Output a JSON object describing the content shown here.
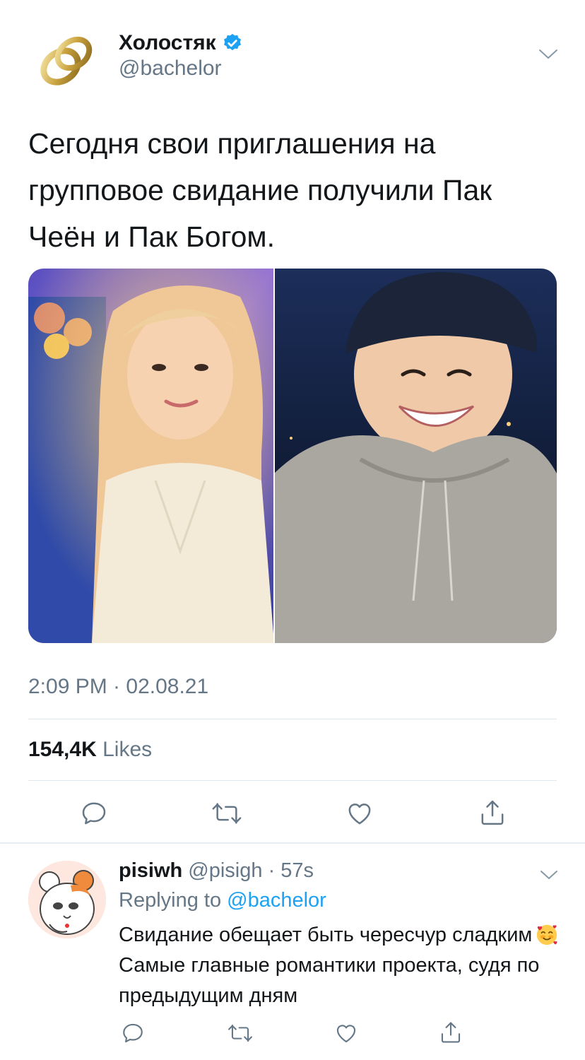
{
  "tweet": {
    "author_name": "Холостяк",
    "author_handle": "@bachelor",
    "text": "Сегодня свои приглашения на групповое свидание получили Пак Чеён и Пак Богом.",
    "timestamp": "2:09 PM · 02.08.21",
    "likes_count": "154,4K",
    "likes_label": "Likes"
  },
  "reply": {
    "author_name": "pisiwh",
    "meta": "@pisigh · 57s",
    "replying_prefix": "Replying to",
    "replying_handle": "@bachelor",
    "text_part1": "Свидание обещает быть чересчур сладким",
    "text_part2": "Самые главные романтики проекта, судя по предыдущим дням"
  },
  "icons": {
    "verified": "verified-badge-icon",
    "reply": "reply-icon",
    "retweet": "retweet-icon",
    "like": "heart-icon",
    "share": "share-icon",
    "chevron": "chevron-down-icon",
    "emoji": "smiling-face-with-hearts-emoji"
  },
  "colors": {
    "accent": "#1da1f2",
    "secondary_text": "#657786",
    "divider": "#e1e8ed"
  }
}
